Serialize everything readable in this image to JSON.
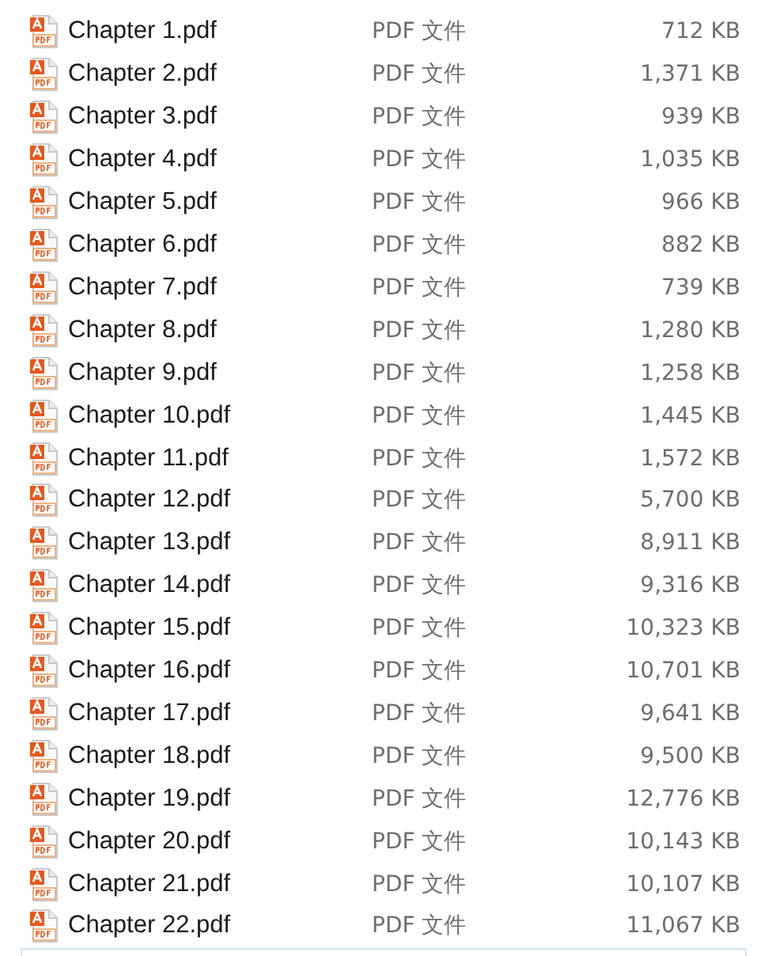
{
  "files": [
    {
      "name": "Chapter 1.pdf",
      "type": "PDF 文件",
      "size": "712 KB"
    },
    {
      "name": "Chapter 2.pdf",
      "type": "PDF 文件",
      "size": "1,371 KB"
    },
    {
      "name": "Chapter 3.pdf",
      "type": "PDF 文件",
      "size": "939 KB"
    },
    {
      "name": "Chapter 4.pdf",
      "type": "PDF 文件",
      "size": "1,035 KB"
    },
    {
      "name": "Chapter 5.pdf",
      "type": "PDF 文件",
      "size": "966 KB"
    },
    {
      "name": "Chapter 6.pdf",
      "type": "PDF 文件",
      "size": "882 KB"
    },
    {
      "name": "Chapter 7.pdf",
      "type": "PDF 文件",
      "size": "739 KB"
    },
    {
      "name": "Chapter 8.pdf",
      "type": "PDF 文件",
      "size": "1,280 KB"
    },
    {
      "name": "Chapter 9.pdf",
      "type": "PDF 文件",
      "size": "1,258 KB"
    },
    {
      "name": "Chapter 10.pdf",
      "type": "PDF 文件",
      "size": "1,445 KB"
    },
    {
      "name": "Chapter 11.pdf",
      "type": "PDF 文件",
      "size": "1,572 KB"
    },
    {
      "name": "Chapter 12.pdf",
      "type": "PDF 文件",
      "size": "5,700 KB"
    },
    {
      "name": "Chapter 13.pdf",
      "type": "PDF 文件",
      "size": "8,911 KB"
    },
    {
      "name": "Chapter 14.pdf",
      "type": "PDF 文件",
      "size": "9,316 KB"
    },
    {
      "name": "Chapter 15.pdf",
      "type": "PDF 文件",
      "size": "10,323 KB"
    },
    {
      "name": "Chapter 16.pdf",
      "type": "PDF 文件",
      "size": "10,701 KB"
    },
    {
      "name": "Chapter 17.pdf",
      "type": "PDF 文件",
      "size": "9,641 KB"
    },
    {
      "name": "Chapter 18.pdf",
      "type": "PDF 文件",
      "size": "9,500 KB"
    },
    {
      "name": "Chapter 19.pdf",
      "type": "PDF 文件",
      "size": "12,776 KB"
    },
    {
      "name": "Chapter 20.pdf",
      "type": "PDF 文件",
      "size": "10,143 KB"
    },
    {
      "name": "Chapter 21.pdf",
      "type": "PDF 文件",
      "size": "10,107 KB"
    },
    {
      "name": "Chapter 22.pdf",
      "type": "PDF 文件",
      "size": "11,067 KB"
    }
  ]
}
